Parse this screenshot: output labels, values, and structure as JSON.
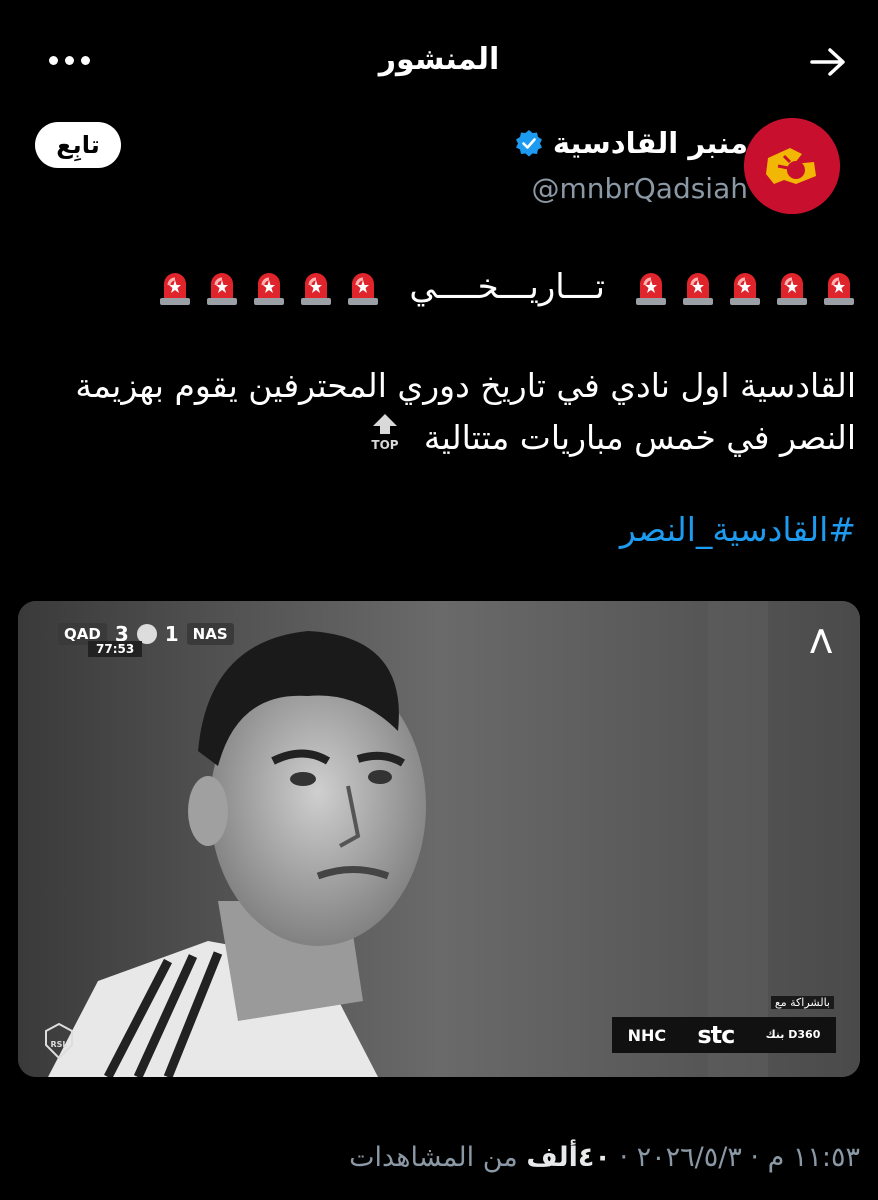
{
  "header": {
    "title": "المنشور",
    "back_icon": "arrow-icon",
    "more_icon": "more-icon"
  },
  "author": {
    "name": "منبر القادسية",
    "handle": "@mnbrQadsiah",
    "verified": true,
    "follow_label": "تابِع",
    "avatar_color": "#c8102e"
  },
  "post": {
    "headline_word": "تـــاريـــخــــي",
    "siren_icon": "siren-emoji",
    "sirens_each_side": 5,
    "body_line1": "القادسية اول نادي في تاريخ دوري المحترفين يقوم بهزيمة",
    "body_line2": "النصر في خمس مباريات متتالية",
    "top_label": "TOP",
    "hashtag": "#القادسية_النصر"
  },
  "media": {
    "scoreboard": {
      "home_team": "QAD",
      "home_score": "3",
      "away_score": "1",
      "away_team": "NAS",
      "clock": "77:53"
    },
    "channel_badge": "⋀",
    "partner_caption": "بالشراكة مع",
    "sponsors": [
      "NHC",
      "stc",
      "بنك D360"
    ],
    "league_logo_text": "RSL"
  },
  "meta": {
    "timestamp": "١١:٥٣ م · ٢٠٢٦/٥/٣",
    "views_count": "٤٠ألف",
    "views_label": "من المشاهدات"
  }
}
